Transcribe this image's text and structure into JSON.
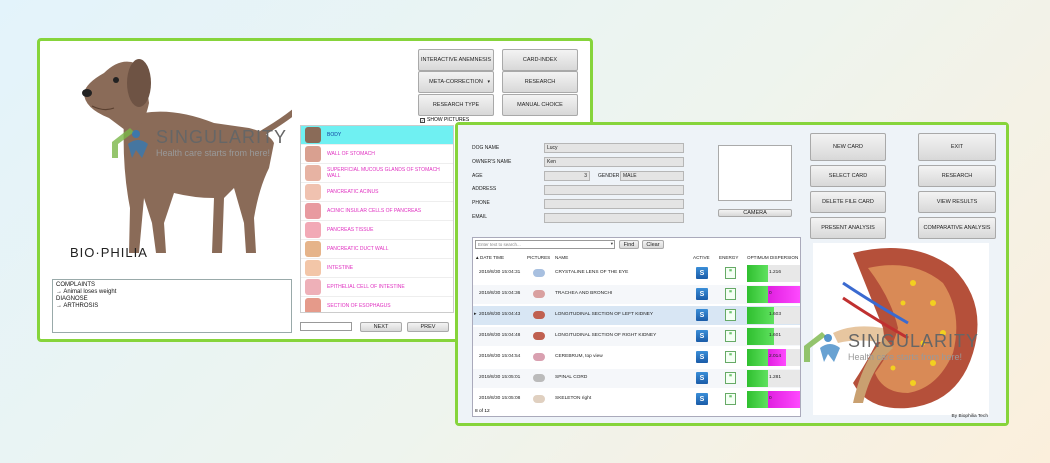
{
  "win1": {
    "brand": "BIO·PHILIA",
    "buttons": {
      "interactive_anemnesis": "INTERACTIVE ANEMNESIS",
      "card_index": "CARD-INDEX",
      "meta_correction": "META-CORRECTION",
      "research": "RESEARCH",
      "research_type": "RESEARCH TYPE",
      "manual_choice": "MANUAL CHOICE",
      "next": "NEXT",
      "prev": "PREV"
    },
    "show_pictures": "SHOW PICTURES",
    "complaints_lines": [
      "COMPLAINTS",
      "→ Animal loses weight",
      "DIAGNOSE",
      "→ ARTHROSIS"
    ],
    "organs": [
      "BODY",
      "WALL OF STOMACH",
      "SUPERFICIAL MUCOUS GLANDS OF STOMACH WALL",
      "PANCREATIC ACINUS",
      "ACINIC INSULAR CELLS OF PANCREAS",
      "PANCREAS TISSUE",
      "PANCREATIC DUCT WALL",
      "INTESTINE",
      "EPITHELIAL CELL OF INTESTINE",
      "SECTION OF ESOPHAGUS"
    ]
  },
  "win2": {
    "labels": {
      "dog_name": "DOG NAME",
      "owner_name": "OWNER'S NAME",
      "age": "AGE",
      "gender": "GENDER",
      "address": "ADDRESS",
      "phone": "PHONE",
      "email": "EMAIL"
    },
    "values": {
      "dog_name": "Lucy",
      "owner_name": "Ken",
      "age": "3",
      "gender": "MALE"
    },
    "camera": "CAMERA",
    "buttons": {
      "new_card": "NEW CARD",
      "exit": "EXIT",
      "select_card": "SELECT CARD",
      "research": "RESEARCH",
      "delete_file_card": "DELETE FILE CARD",
      "view_results": "VIEW RESULTS",
      "present_analysis": "PRESENT ANALYSIS",
      "comparative_analysis": "COMPARATIVE ANALYSIS"
    },
    "search_placeholder": "Enter text to search...",
    "find": "Find",
    "clear": "Clear",
    "columns": {
      "date_time": "DATE TIME",
      "pictures": "PICTURES",
      "name": "NAME",
      "active": "ACTIVE",
      "energy": "ENERGY",
      "optimum_dispersion": "OPTIMUM DISPERSION"
    },
    "rows": [
      {
        "date": "2019/8/30 15:04:31",
        "name": "CRYSTALINE LENS OF THE EYE",
        "value": "1.216",
        "green": 0.38,
        "magenta": 0.0
      },
      {
        "date": "2019/8/30 15:04:36",
        "name": "TRACHEA  AND  BRONCHI",
        "value": "0",
        "green": 0.38,
        "magenta": 0.62
      },
      {
        "date": "2019/8/30 15:04:43",
        "name": "LONGITUDINAL  SECTION  OF  LEFT KIDNEY",
        "value": "1.603",
        "green": 0.5,
        "magenta": 0.0
      },
      {
        "date": "2019/8/30 15:04:48",
        "name": "LONGITUDINAL  SECTION  OF  RIGHT  KIDNEY",
        "value": "1.601",
        "green": 0.5,
        "magenta": 0.0
      },
      {
        "date": "2019/8/30 15:04:54",
        "name": "CEREBRUM, top view",
        "value": "2.014",
        "green": 0.38,
        "magenta": 0.35
      },
      {
        "date": "2019/8/30 15:05:01",
        "name": "SPINAL CORD",
        "value": "1.281",
        "green": 0.38,
        "magenta": 0.0
      },
      {
        "date": "2019/8/30 15:05:08",
        "name": "SKELETON right",
        "value": "0",
        "green": 0.38,
        "magenta": 0.62
      }
    ],
    "active_label": "S",
    "pager": "8 of 12",
    "footer": "By Biophilia Tech"
  },
  "watermark": {
    "name": "SINGULARITY",
    "tagline": "Health care starts from here!"
  },
  "colors": {
    "window_border": "#86d43b",
    "organ_text": "#e030c0",
    "organ_active": "#6ff0f2"
  }
}
